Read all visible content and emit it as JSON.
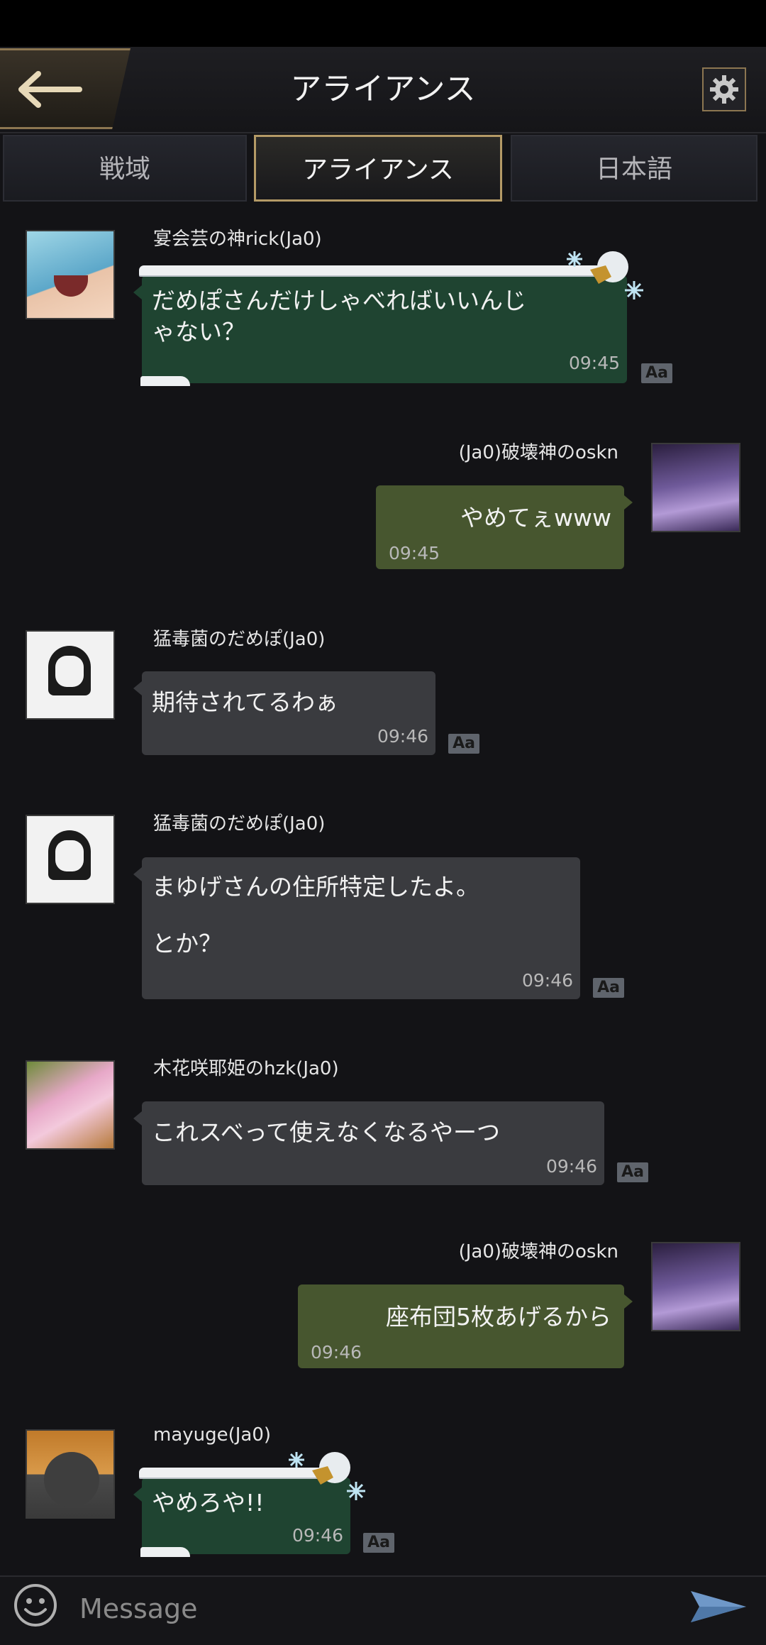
{
  "header": {
    "title": "アライアンス",
    "back_icon": "back-arrow-icon",
    "settings_icon": "gear-icon"
  },
  "tabs": [
    {
      "label": "戦域",
      "active": false
    },
    {
      "label": "アライアンス",
      "active": true
    },
    {
      "label": "日本語",
      "active": false
    }
  ],
  "messages": [
    {
      "sender": "宴会芸の神rick(Ja0)",
      "text": "だめぽさんだけしゃべればいいんじ\nゃない？",
      "time": "09:45",
      "side": "left",
      "style": "green-snow"
    },
    {
      "sender": "(Ja0)破壊神のoskn",
      "text": "やめてぇwww",
      "time": "09:45",
      "side": "right",
      "style": "olive"
    },
    {
      "sender": "猛毒菌のだめぽ(Ja0)",
      "text": "期待されてるわぁ",
      "time": "09:46",
      "side": "left",
      "style": "gray"
    },
    {
      "sender": "猛毒菌のだめぽ(Ja0)",
      "text": "まゆげさんの住所特定したよ。\n\nとか？",
      "time": "09:46",
      "side": "left",
      "style": "gray"
    },
    {
      "sender": "木花咲耶姫のhzk(Ja0)",
      "text": "これスベって使えなくなるやーつ",
      "time": "09:46",
      "side": "left",
      "style": "gray"
    },
    {
      "sender": "(Ja0)破壊神のoskn",
      "text": "座布団5枚あげるから",
      "time": "09:46",
      "side": "right",
      "style": "olive"
    },
    {
      "sender": "mayuge(Ja0)",
      "text": "やめろや!!",
      "time": "09:46",
      "side": "left",
      "style": "green-snow"
    }
  ],
  "translate_label": "Aa",
  "input": {
    "placeholder": "Message",
    "emoji_icon": "smiley-icon",
    "send_icon": "send-arrow-icon"
  }
}
